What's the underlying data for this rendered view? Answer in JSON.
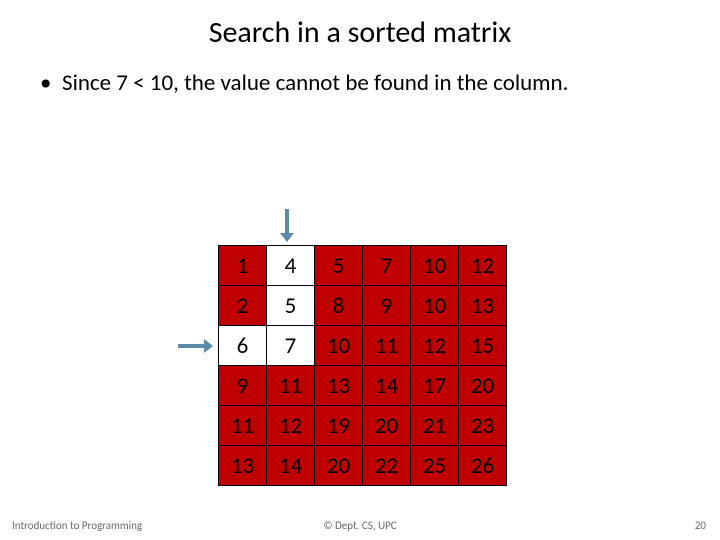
{
  "title": "Search in a sorted matrix",
  "bullet": "Since 7 < 10, the value cannot be found in the column.",
  "matrix": [
    [
      1,
      4,
      5,
      7,
      10,
      12
    ],
    [
      2,
      5,
      8,
      9,
      10,
      13
    ],
    [
      6,
      7,
      10,
      11,
      12,
      15
    ],
    [
      9,
      11,
      13,
      14,
      17,
      20
    ],
    [
      11,
      12,
      19,
      20,
      21,
      23
    ],
    [
      13,
      14,
      20,
      22,
      25,
      26
    ]
  ],
  "white_cells": [
    [
      0,
      1
    ],
    [
      1,
      1
    ],
    [
      2,
      0
    ],
    [
      2,
      1
    ]
  ],
  "arrow_down_col": 1,
  "arrow_right_row": 2,
  "footer": {
    "left": "Introduction to Programming",
    "center": "© Dept. CS, UPC",
    "right": "20"
  }
}
